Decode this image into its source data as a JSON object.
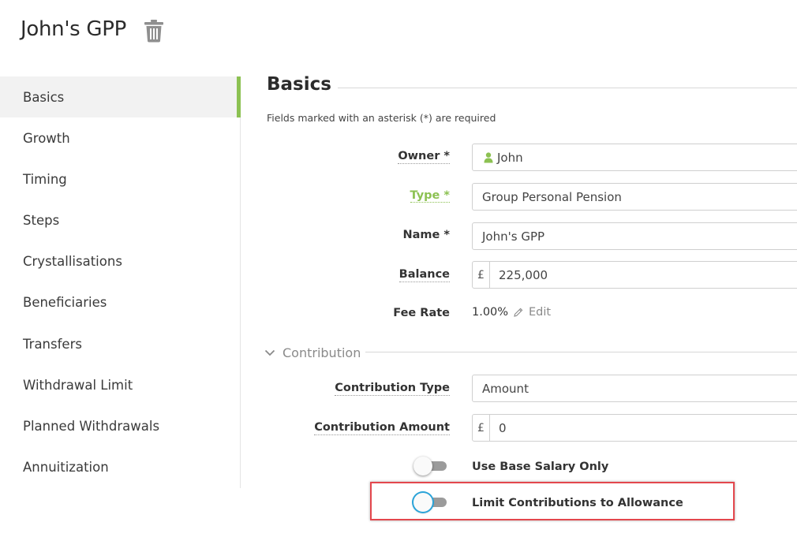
{
  "header": {
    "title": "John's GPP"
  },
  "sidebar": {
    "items": [
      {
        "label": "Basics"
      },
      {
        "label": "Growth"
      },
      {
        "label": "Timing"
      },
      {
        "label": "Steps"
      },
      {
        "label": "Crystallisations"
      },
      {
        "label": "Beneficiaries"
      },
      {
        "label": "Transfers"
      },
      {
        "label": "Withdrawal Limit"
      },
      {
        "label": "Planned Withdrawals"
      },
      {
        "label": "Annuitization"
      }
    ]
  },
  "section": {
    "title": "Basics",
    "required_note": "Fields marked with an asterisk (*) are required"
  },
  "form": {
    "owner": {
      "label": "Owner *",
      "value": "John"
    },
    "type": {
      "label": "Type *",
      "value": "Group Personal Pension"
    },
    "name": {
      "label": "Name *",
      "value": "John's GPP"
    },
    "balance": {
      "label": "Balance",
      "currency": "£",
      "value": "225,000"
    },
    "fee_rate": {
      "label": "Fee Rate",
      "value": "1.00%",
      "edit_label": "Edit"
    }
  },
  "contribution": {
    "heading": "Contribution",
    "type": {
      "label": "Contribution Type",
      "value": "Amount"
    },
    "amount": {
      "label": "Contribution Amount",
      "currency": "£",
      "value": "0"
    },
    "base_salary_only": {
      "label": "Use Base Salary Only",
      "checked": false
    },
    "limit_allowance": {
      "label": "Limit Contributions to Allowance",
      "checked": false
    }
  },
  "colors": {
    "accent": "#8cc152",
    "highlight": "#e3474d",
    "focus": "#2aa3d8"
  }
}
